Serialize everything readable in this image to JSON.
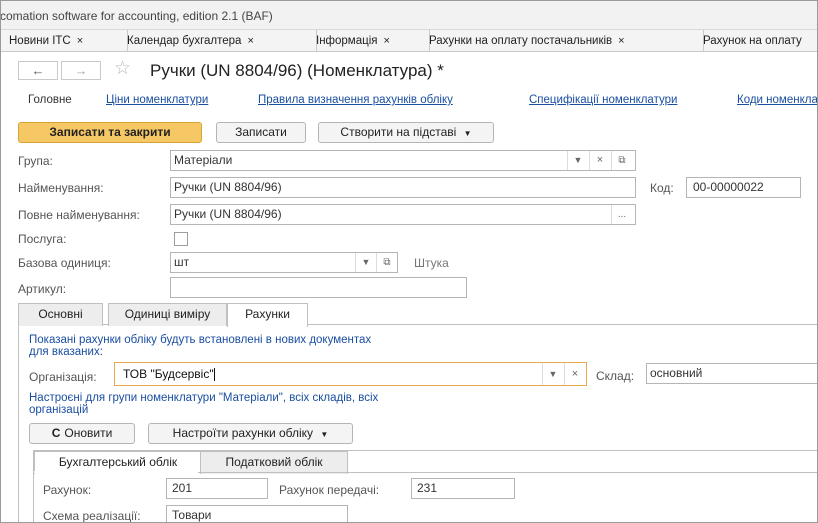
{
  "window": {
    "app_title": "comation software for accounting, edition 2.1  (BAF)",
    "tabs": [
      {
        "label": "Новини ІТС"
      },
      {
        "label": "Календар бухгалтера"
      },
      {
        "label": "Інформація"
      },
      {
        "label": "Рахунки на оплату постачальників"
      },
      {
        "label": "Рахунок на оплату"
      }
    ],
    "close_glyph": "×"
  },
  "header": {
    "back": "←",
    "forward": "→",
    "star": "☆",
    "title": "Ручки (UN 8804/96) (Номенклатура) *"
  },
  "nav": {
    "main": "Головне",
    "prices": "Ціни номенклатури",
    "rules": "Правила визначення рахунків обліку",
    "specs": "Специфікації номенклатури",
    "codes": "Коди номенклатури"
  },
  "toolbar": {
    "save_close": "Записати та закрити",
    "save": "Записати",
    "create_based": "Створити на підставі"
  },
  "form": {
    "group_label": "Група:",
    "group_value": "Матеріали",
    "name_label": "Найменування:",
    "name_value": "Ручки (UN 8804/96)",
    "code_label": "Код:",
    "code_value": "00-00000022",
    "fullname_label": "Повне найменування:",
    "fullname_value": "Ручки (UN 8804/96)",
    "service_label": "Послуга:",
    "unit_label": "Базова одиниця:",
    "unit_value": "шт",
    "unit_hint": "Штука",
    "article_label": "Артикул:",
    "article_value": "",
    "ellipsis": "..."
  },
  "page_tabs": [
    {
      "label": "Основні"
    },
    {
      "label": "Одиниці виміру"
    },
    {
      "label": "Рахунки"
    }
  ],
  "accounts": {
    "info_line1": "Показані рахунки обліку будуть встановлені в нових документах",
    "info_line2": "для вказаних:",
    "org_label": "Організація:",
    "org_value": "ТОВ \"Будсервіс\"",
    "warehouse_label": "Склад:",
    "warehouse_value": "основний",
    "config_line1": "Настроєні для групи номенклатури \"Матеріали\", всіх складів, всіх",
    "config_line2": "організацій",
    "refresh": "Оновити",
    "configure": "Настроїти рахунки обліку",
    "subtabs": [
      {
        "label": "Бухгалтерський облік"
      },
      {
        "label": "Податковий облік"
      }
    ],
    "account_label": "Рахунок:",
    "account_value": "201",
    "transfer_label": "Рахунок передачі:",
    "transfer_value": "231",
    "scheme_label": "Схема реалізації:",
    "scheme_value": "Товари"
  }
}
